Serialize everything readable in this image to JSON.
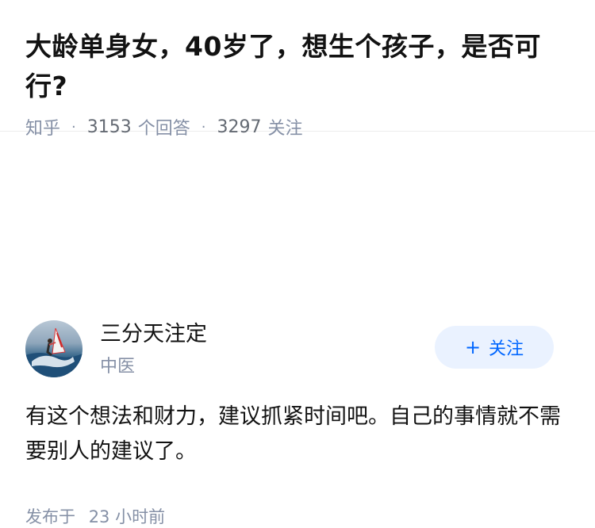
{
  "question": {
    "title": "大龄单身女，40岁了，想生个孩子，是否可行?",
    "source": "知乎",
    "answer_count": "3153",
    "answer_label": "个回答",
    "follow_count": "3297",
    "follow_label": "关注"
  },
  "answer": {
    "author_name": "三分天注定",
    "author_tag": "中医",
    "follow_button": {
      "icon": "+",
      "label": "关注"
    },
    "content": "有这个想法和财力，建议抓紧时间吧。自己的事情就不需要别人的建议了。",
    "published_prefix": "发布于",
    "published_time": "23 小时前"
  },
  "colors": {
    "accent": "#0066ff",
    "follow_bg": "#eaf2ff",
    "meta_text": "#8590a6"
  }
}
